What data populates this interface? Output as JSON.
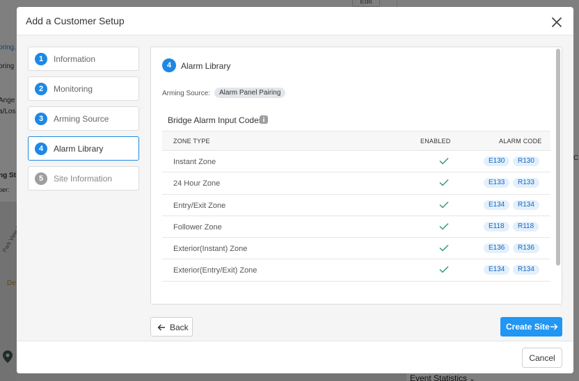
{
  "background": {
    "edit_label": "Edit",
    "fragments": [
      "oring.",
      "oring",
      "Ange",
      "a/Los",
      "ng St",
      "ber:",
      "Park View St",
      "De",
      "C"
    ],
    "event_statistics": "Event Statistics"
  },
  "modal": {
    "title": "Add a Customer Setup",
    "cancel_label": "Cancel",
    "back_label": "Back",
    "create_label": "Create Site"
  },
  "steps": [
    {
      "number": "1",
      "label": "Information",
      "state": "complete"
    },
    {
      "number": "2",
      "label": "Monitoring",
      "state": "complete"
    },
    {
      "number": "3",
      "label": "Arming Source",
      "state": "complete"
    },
    {
      "number": "4",
      "label": "Alarm Library",
      "state": "active"
    },
    {
      "number": "5",
      "label": "Site Information",
      "state": "disabled"
    }
  ],
  "content": {
    "step_number": "4",
    "title": "Alarm Library",
    "arming_source_label": "Arming Source:",
    "arming_source_value": "Alarm Panel Pairing",
    "section_title": "Bridge Alarm Input Codes",
    "table": {
      "headers": [
        "ZONE TYPE",
        "ENABLED",
        "ALARM CODE"
      ],
      "rows": [
        {
          "zone": "Instant Zone",
          "enabled": true,
          "codes": [
            "E130",
            "R130"
          ]
        },
        {
          "zone": "24 Hour Zone",
          "enabled": true,
          "codes": [
            "E133",
            "R133"
          ]
        },
        {
          "zone": "Entry/Exit Zone",
          "enabled": true,
          "codes": [
            "E134",
            "R134"
          ]
        },
        {
          "zone": "Follower Zone",
          "enabled": true,
          "codes": [
            "E118",
            "R118"
          ]
        },
        {
          "zone": "Exterior(Instant) Zone",
          "enabled": true,
          "codes": [
            "E136",
            "R136"
          ]
        },
        {
          "zone": "Exterior(Entry/Exit) Zone",
          "enabled": true,
          "codes": [
            "E134",
            "R134"
          ]
        }
      ]
    }
  },
  "colors": {
    "accent": "#1e88e5",
    "primary_button": "#2196f3",
    "check": "#2e9e6b",
    "chip_bg": "#e3f0fb",
    "chip_text": "#1565c0"
  }
}
